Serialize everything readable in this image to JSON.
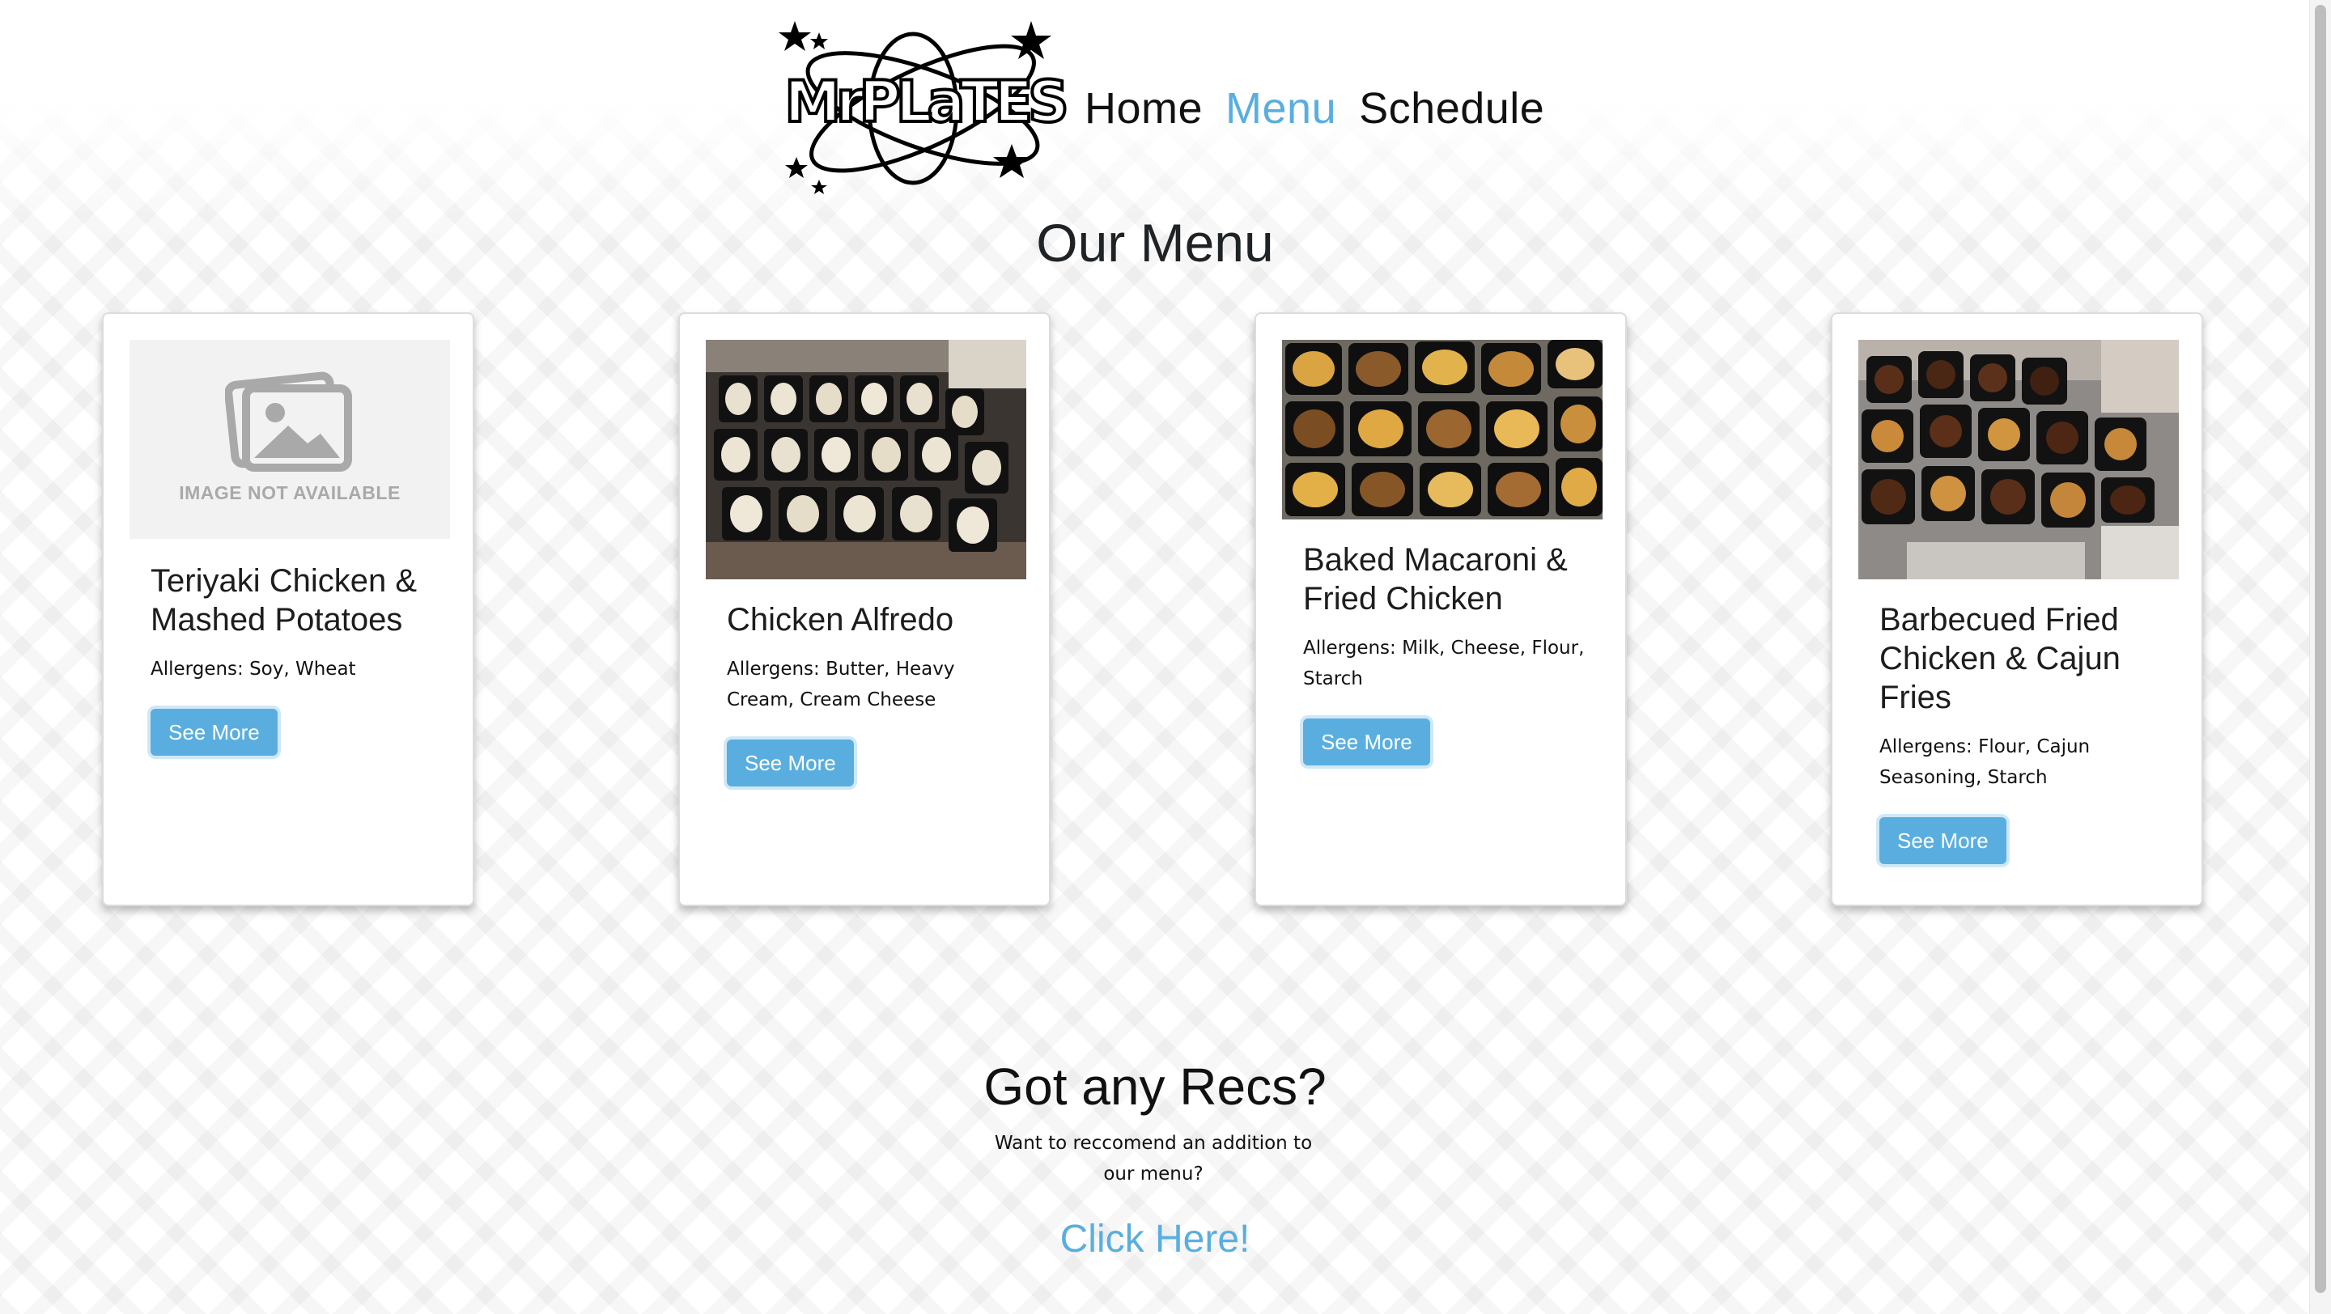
{
  "header": {
    "logo_text": "MrPlates",
    "nav": [
      {
        "label": "Home",
        "active": false
      },
      {
        "label": "Menu",
        "active": true
      },
      {
        "label": "Schedule",
        "active": false
      }
    ]
  },
  "page_title": "Our Menu",
  "menu": {
    "items": [
      {
        "title": "Teriyaki Chicken & Mashed Potatoes",
        "allergens": "Allergens: Soy, Wheat",
        "button": "See More",
        "image": "placeholder-image-icon",
        "image_text": "IMAGE NOT AVAILABLE"
      },
      {
        "title": "Chicken Alfredo",
        "allergens": "Allergens: Butter, Heavy Cream, Cream Cheese",
        "button": "See More",
        "image": "food-photo-chicken-alfredo"
      },
      {
        "title": "Baked Macaroni & Fried Chicken",
        "allergens": "Allergens: Milk, Cheese, Flour, Starch",
        "button": "See More",
        "image": "food-photo-macaroni-chicken"
      },
      {
        "title": "Barbecued Fried Chicken & Cajun Fries",
        "allergens": "Allergens: Flour, Cajun Seasoning, Starch",
        "button": "See More",
        "image": "food-photo-bbq-chicken-fries"
      }
    ]
  },
  "recs": {
    "title": "Got any Recs?",
    "subtitle": "Want to reccomend an addition to our menu?",
    "link": "Click Here!"
  },
  "colors": {
    "accent": "#5aaedf",
    "text": "#1d1d1f",
    "placeholder_bg": "#f2f2f2"
  }
}
